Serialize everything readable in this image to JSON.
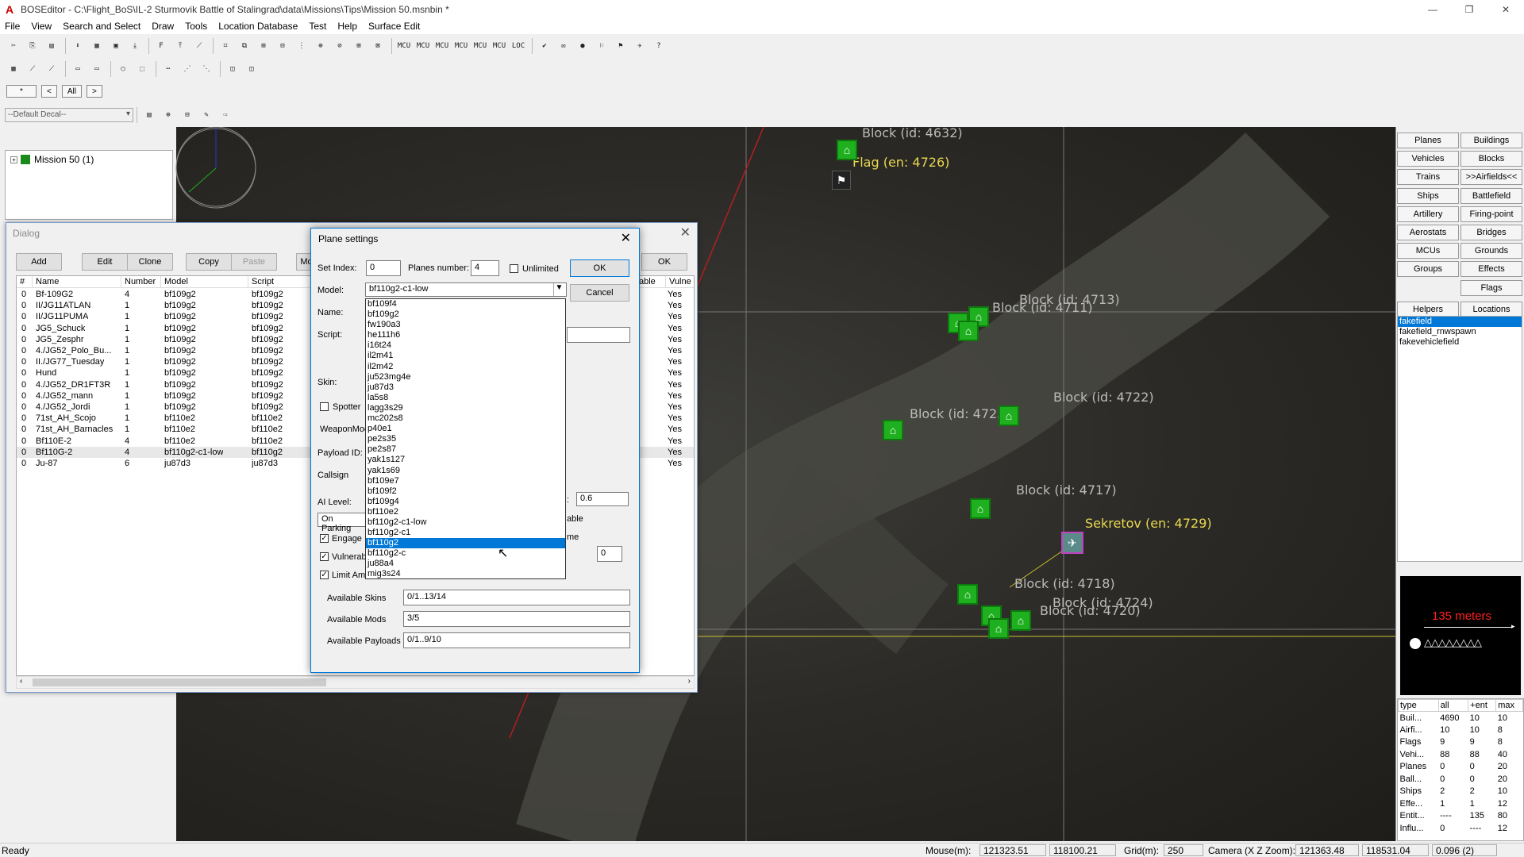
{
  "window": {
    "title": "BOSEditor - C:\\Flight_BoS\\IL-2 Sturmovik Battle of Stalingrad\\data\\Missions\\Tips\\Mission 50.msnbin *",
    "min": "—",
    "max": "❐",
    "close": "✕"
  },
  "menu": [
    "File",
    "View",
    "Search and Select",
    "Draw",
    "Tools",
    "Location Database",
    "Test",
    "Help",
    "Surface Edit"
  ],
  "toolbar1": [
    "✂",
    "⎘",
    "▤",
    "⬇",
    "▦",
    "▣",
    "⤓",
    "F",
    "⤒",
    "⟋",
    "⌗",
    "⧉",
    "⊞",
    "⊟",
    "⋮",
    "⊕",
    "⊘",
    "⊞",
    "⊠",
    "MCU",
    "MCU",
    "MCU",
    "MCU",
    "MCU",
    "MCU",
    "LOC",
    "✔",
    "✉",
    "●",
    "⚐",
    "⚑",
    "✈",
    "?"
  ],
  "toolbar2_small": [
    "*",
    "<",
    "All",
    ">"
  ],
  "decal_select": "--Default Decal--",
  "tree": {
    "root": "Mission 50 (1)"
  },
  "dialog": {
    "title": "Dialog",
    "buttons": {
      "add": "Add",
      "edit": "Edit",
      "clone": "Clone",
      "copy": "Copy",
      "paste": "Paste",
      "mo": "Mo",
      "ok": "OK"
    },
    "columns": [
      "#",
      "Name",
      "Number",
      "Model",
      "Script",
      "able",
      "Vulne"
    ],
    "rows": [
      [
        "0",
        "Bf-109G2",
        "4",
        "bf109g2",
        "bf109g2",
        "Yes"
      ],
      [
        "0",
        "II/JG11ATLAN",
        "1",
        "bf109g2",
        "bf109g2",
        "Yes"
      ],
      [
        "0",
        "II/JG11PUMA",
        "1",
        "bf109g2",
        "bf109g2",
        "Yes"
      ],
      [
        "0",
        "JG5_Schuck",
        "1",
        "bf109g2",
        "bf109g2",
        "Yes"
      ],
      [
        "0",
        "JG5_Zesphr",
        "1",
        "bf109g2",
        "bf109g2",
        "Yes"
      ],
      [
        "0",
        "4./JG52_Polo_Bu...",
        "1",
        "bf109g2",
        "bf109g2",
        "Yes"
      ],
      [
        "0",
        "II./JG77_Tuesday",
        "1",
        "bf109g2",
        "bf109g2",
        "Yes"
      ],
      [
        "0",
        "Hund",
        "1",
        "bf109g2",
        "bf109g2",
        "Yes"
      ],
      [
        "0",
        "4./JG52_DR1FT3R",
        "1",
        "bf109g2",
        "bf109g2",
        "Yes"
      ],
      [
        "0",
        "4./JG52_mann",
        "1",
        "bf109g2",
        "bf109g2",
        "Yes"
      ],
      [
        "0",
        "4./JG52_Jordi",
        "1",
        "bf109g2",
        "bf109g2",
        "Yes"
      ],
      [
        "0",
        "71st_AH_Scojo",
        "1",
        "bf110e2",
        "bf110e2",
        "Yes"
      ],
      [
        "0",
        "71st_AH_Barnacles",
        "1",
        "bf110e2",
        "bf110e2",
        "Yes"
      ],
      [
        "0",
        "Bf110E-2",
        "4",
        "bf110e2",
        "bf110e2",
        "Yes"
      ],
      [
        "0",
        "Bf110G-2",
        "4",
        "bf110g2-c1-low",
        "bf110g2",
        "Yes"
      ],
      [
        "0",
        "Ju-87",
        "6",
        "ju87d3",
        "ju87d3",
        "Yes"
      ]
    ]
  },
  "plane": {
    "title": "Plane settings",
    "set_index_label": "Set Index:",
    "set_index": "0",
    "planes_number_label": "Planes number:",
    "planes_number": "4",
    "unlimited": "Unlimited",
    "ok": "OK",
    "cancel": "Cancel",
    "model_label": "Model:",
    "model": "bf110g2-c1-low",
    "name_label": "Name:",
    "script_label": "Script:",
    "skin_label": "Skin:",
    "spotter": "Spotter",
    "weaponmod_label": "WeaponMod",
    "payload_label": "Payload ID:",
    "callsign_label": "Callsign",
    "ailevel_label": "AI Level:",
    "ai_value": "0.6",
    "onparking": "On Parking",
    "engage": "Engage",
    "vulnerable": "Vulnerab",
    "limitammo": "Limit Amr",
    "frag_able": "able",
    "frag_me": "me",
    "frag_colon": ":",
    "num_zero": "0",
    "avail_skins_label": "Available Skins",
    "avail_skins": "0/1..13/14",
    "avail_mods_label": "Available Mods",
    "avail_mods": "3/5",
    "avail_payloads_label": "Available Payloads",
    "avail_payloads": "0/1..9/10",
    "dropdown": [
      "bf109f4",
      "bf109g2",
      "fw190a3",
      "he111h6",
      "i16t24",
      "il2m41",
      "il2m42",
      "ju523mg4e",
      "ju87d3",
      "la5s8",
      "lagg3s29",
      "mc202s8",
      "p40e1",
      "pe2s35",
      "pe2s87",
      "yak1s127",
      "yak1s69",
      "bf109e7",
      "bf109f2",
      "bf109g4",
      "bf110e2",
      "bf110g2-c1-low",
      "bf110g2-c1",
      "bf110g2",
      "bf110g2-c",
      "ju88a4",
      "mig3s24"
    ],
    "dropdown_selected": 23
  },
  "map_labels": [
    {
      "text": "Block (id: 4632)"
    },
    {
      "text": "Flag (en: 4726)"
    },
    {
      "text": "Block (id: 4713)"
    },
    {
      "text": "Block (id: 4711)"
    },
    {
      "text": "Block (id: 4723)"
    },
    {
      "text": "Block (id: 4722)"
    },
    {
      "text": "Block (id: 4717)"
    },
    {
      "text": "Sekretov (en: 4729)"
    },
    {
      "text": "Block (id: 4718)"
    },
    {
      "text": "Block (id: 4724)"
    },
    {
      "text": "Block (id: 4720)"
    }
  ],
  "right_buttons": [
    "Planes",
    "Buildings",
    "Vehicles",
    "Blocks",
    "Trains",
    ">>Airfields<<",
    "Ships",
    "Battlefield",
    "Artillery",
    "Firing-point",
    "Aerostats",
    "Bridges",
    "MCUs",
    "Grounds",
    "Groups",
    "Effects",
    "",
    "Flags",
    "Helpers",
    "Locations"
  ],
  "locations": [
    "fakefield",
    "fakefield_rnwspawn",
    "fakevehiclefield"
  ],
  "scale": {
    "text": "135 meters",
    "glyphs": "△△△△△△△△"
  },
  "stats": {
    "headers": [
      "type",
      "all",
      "+ent",
      "max"
    ],
    "rows": [
      [
        "Buil...",
        "4690",
        "10",
        "10"
      ],
      [
        "Airfi...",
        "10",
        "10",
        "8"
      ],
      [
        "Flags",
        "9",
        "9",
        "8"
      ],
      [
        "Vehi...",
        "88",
        "88",
        "40"
      ],
      [
        "Planes",
        "0",
        "0",
        "20"
      ],
      [
        "Ball...",
        "0",
        "0",
        "20"
      ],
      [
        "Ships",
        "2",
        "2",
        "10"
      ],
      [
        "Effe...",
        "1",
        "1",
        "12"
      ],
      [
        "Entit...",
        "----",
        "135",
        "80"
      ],
      [
        "Influ...",
        "0",
        "----",
        "12"
      ]
    ]
  },
  "status": {
    "ready": "Ready",
    "mouse_label": "Mouse(m):",
    "mouse_x": "121323.51",
    "mouse_z": "118100.21",
    "grid_label": "Grid(m):",
    "grid": "250",
    "camera_label": "Camera (X Z Zoom):",
    "cam_x": "121363.48",
    "cam_z": "118531.04",
    "zoom": "0.096 (2)"
  },
  "colors": {
    "accent": "#0078d7",
    "house": "#1fb01f",
    "label_yellow": "#e8d850",
    "scale_red": "#ff2020"
  }
}
